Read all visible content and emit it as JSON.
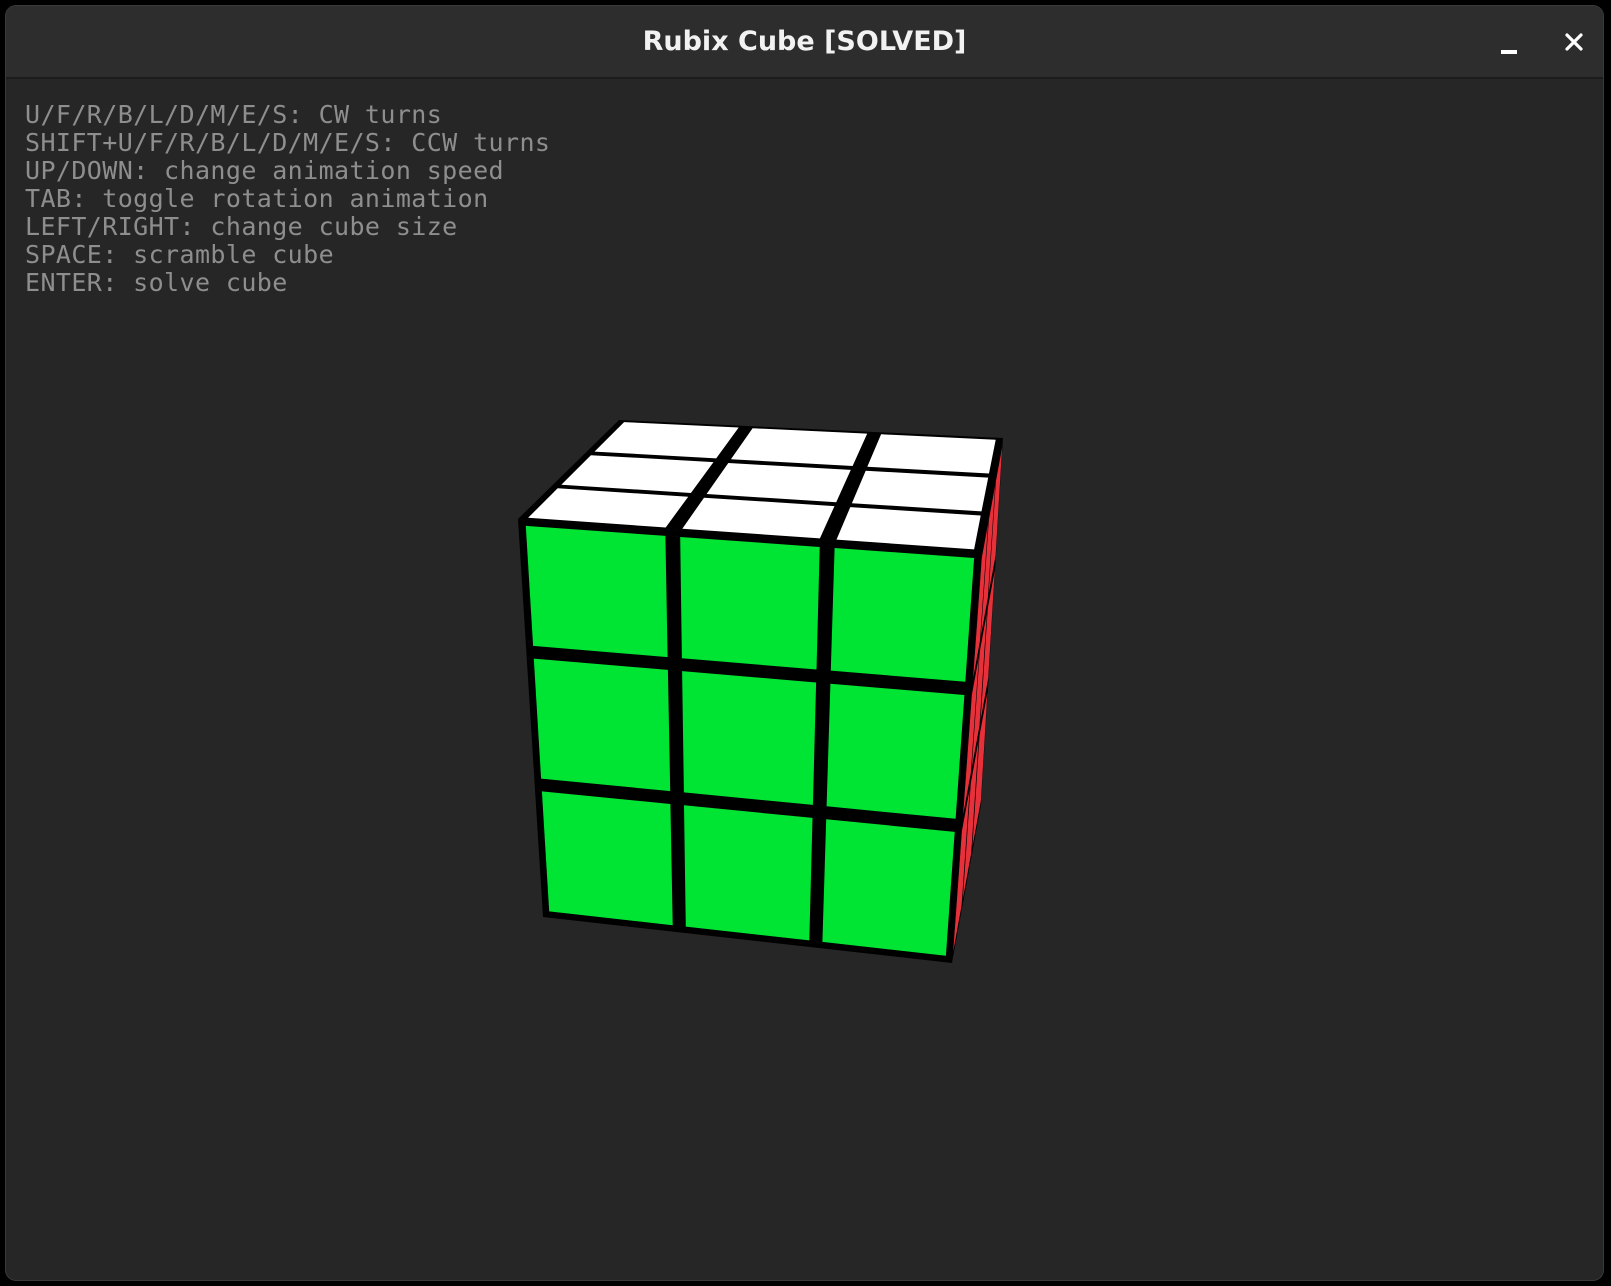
{
  "window": {
    "title": "Rubix Cube [SOLVED]"
  },
  "controls": {
    "minimize_icon": "minimize-icon",
    "close_icon": "close-icon"
  },
  "help_lines": [
    "U/F/R/B/L/D/M/E/S: CW turns",
    "SHIFT+U/F/R/B/L/D/M/E/S: CCW turns",
    "UP/DOWN: change animation speed",
    "TAB: toggle rotation animation",
    "LEFT/RIGHT: change cube size",
    "SPACE: scramble cube",
    "ENTER: solve cube"
  ],
  "cube": {
    "size": 3,
    "state": "solved",
    "visible_faces": {
      "front": {
        "color": "#00e533",
        "stickers": 9
      },
      "top": {
        "color": "#ffffff",
        "stickers": 9
      },
      "right": {
        "color": "#e6303a",
        "stickers": 9
      }
    },
    "gap_color": "#000000"
  }
}
